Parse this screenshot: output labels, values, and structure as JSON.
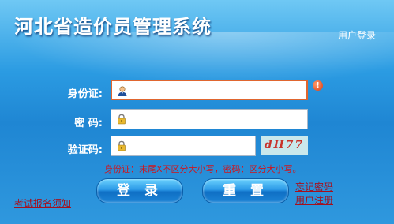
{
  "header": {
    "title": "河北省造价员管理系统",
    "user_login": "用户登录"
  },
  "form": {
    "id_label": "身份证:",
    "password_label": "密 码:",
    "captcha_label": "验证码:",
    "id_value": "",
    "password_value": "",
    "captcha_value": "",
    "captcha_image_text": "dH77",
    "warning_glyph": "!",
    "hint": "身份证：末尾X不区分大小写，密码：区分大小写。"
  },
  "buttons": {
    "login": "登 录",
    "reset": "重 置"
  },
  "links": {
    "exam_notice": "考试报名须知",
    "forgot_password": "忘记密码",
    "register": "用户注册"
  },
  "colors": {
    "accent_border": "#e0662f",
    "hint_text": "#d0141c",
    "link_text": "#a5101c"
  },
  "icons": {
    "id_field": "user-avatar-icon",
    "password_field": "lock-icon",
    "captcha_field": "lock-icon",
    "warning": "warning-icon"
  }
}
